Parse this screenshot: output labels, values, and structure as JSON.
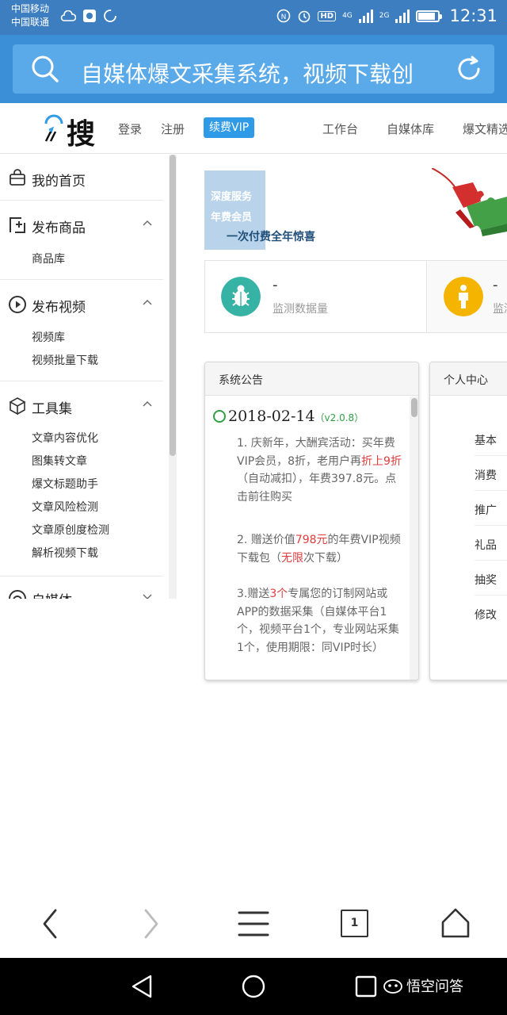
{
  "status_bar": {
    "carrier_1": "中国移动",
    "carrier_2": "中国联通",
    "network_1": "4G",
    "network_2": "2G",
    "hd_label": "HD",
    "time": "12:31",
    "battery_level": 0.85
  },
  "search": {
    "text": "自媒体爆文采集系统，视频下载创"
  },
  "header": {
    "logo_text": "搜",
    "login": "登录",
    "register": "注册",
    "vip": "续费VIP",
    "nav": [
      "工作台",
      "自媒体库",
      "爆文精选"
    ]
  },
  "sidebar": {
    "home": "我的首页",
    "groups": [
      {
        "title": "发布商品",
        "items": [
          "商品库"
        ]
      },
      {
        "title": "发布视频",
        "items": [
          "视频库",
          "视频批量下载"
        ]
      },
      {
        "title": "工具集",
        "items": [
          "文章内容优化",
          "图集转文章",
          "爆文标题助手",
          "文章风险检测",
          "文章原创度检测",
          "解析视频下载"
        ]
      },
      {
        "title": "自媒体",
        "items": []
      }
    ]
  },
  "banner": {
    "line1": "深度服务",
    "line2": "年费会员",
    "slogan": "一次付费全年惊喜"
  },
  "stats": [
    {
      "value": "-",
      "label": "监测数据量",
      "icon": "bug-icon",
      "color": "#37b3a6"
    },
    {
      "value": "-",
      "label": "监测",
      "icon": "person-icon",
      "color": "#f5b400"
    }
  ],
  "notice": {
    "title": "系统公告",
    "date": "2018-02-14",
    "version": "（v2.0.8）",
    "items": [
      [
        {
          "t": "1. 庆新年，大酬宾活动：买年费VIP会员，8折，老用户再"
        },
        {
          "t": "折上9折",
          "red": true
        },
        {
          "t": "（自动减扣），年费397.8元。点击前往购买"
        }
      ],
      [
        {
          "t": "2. 赠送价值"
        },
        {
          "t": "798元",
          "red": true
        },
        {
          "t": "的年费VIP视频下载包（"
        },
        {
          "t": "无限",
          "red": true
        },
        {
          "t": "次下载）"
        }
      ],
      [
        {
          "t": "3.赠送"
        },
        {
          "t": "3个",
          "red": true
        },
        {
          "t": "专属您的订制网站或APP的数据采集（自媒体平台1个，视频平台1个，专业网站采集1个，使用期限：同VIP时长）"
        }
      ]
    ]
  },
  "personal": {
    "title": "个人中心",
    "rows": [
      "基本",
      "消费",
      "推广",
      "礼品",
      "抽奖",
      "修改"
    ]
  },
  "toolbar": {
    "tab_count": "1"
  },
  "watermark": "悟空问答",
  "colors": {
    "status_bar": "#3d7ec0",
    "search_bar": "#3a8fd6",
    "vip": "#2f9be6",
    "highlight_red": "#e03c3c",
    "version_green": "#2ea043"
  }
}
